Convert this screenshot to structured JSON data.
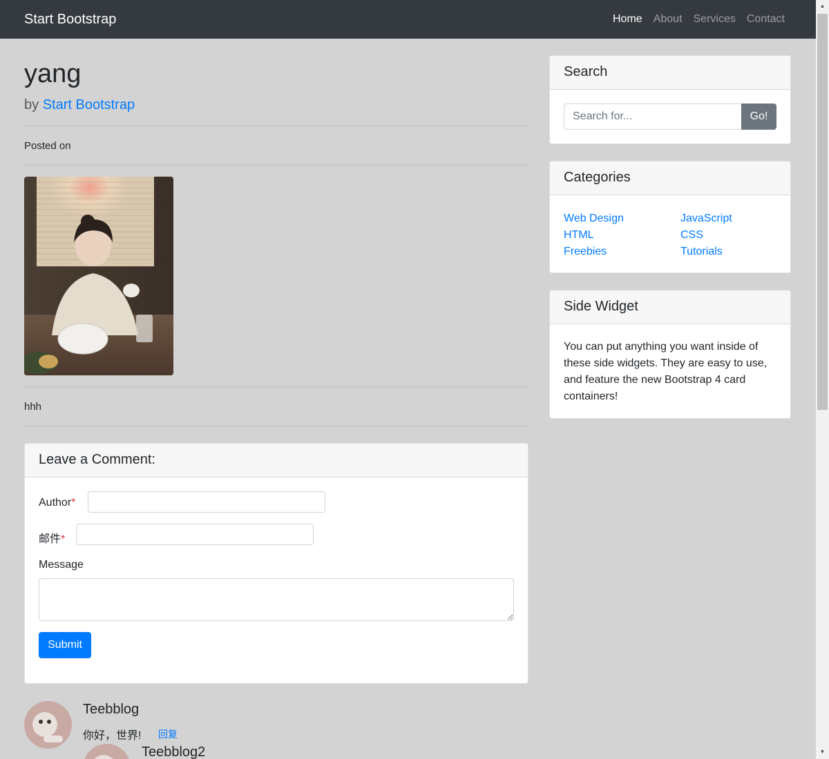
{
  "navbar": {
    "brand": "Start Bootstrap",
    "links": [
      "Home",
      "About",
      "Services",
      "Contact"
    ],
    "active": "Home"
  },
  "post": {
    "title": "yang",
    "by_prefix": "by",
    "author": "Start Bootstrap",
    "posted_on": "Posted on",
    "body": "hhh"
  },
  "search": {
    "title": "Search",
    "placeholder": "Search for...",
    "button": "Go!"
  },
  "categories": {
    "title": "Categories",
    "left": [
      "Web Design",
      "HTML",
      "Freebies"
    ],
    "right": [
      "JavaScript",
      "CSS",
      "Tutorials"
    ]
  },
  "side_widget": {
    "title": "Side Widget",
    "text": "You can put anything you want inside of these side widgets. They are easy to use, and feature the new Bootstrap 4 card containers!"
  },
  "comment_form": {
    "title": "Leave a Comment:",
    "author_label": "Author",
    "email_label": "邮件",
    "required_mark": "*",
    "message_label": "Message",
    "submit": "Submit"
  },
  "comments": [
    {
      "name": "Teebblog",
      "text": "你好，世界!",
      "reply": "回复"
    },
    {
      "name": "Teebblog2"
    }
  ],
  "colors": {
    "navbar": "#343a40",
    "page_bg": "#d3d3d3",
    "link": "#007bff",
    "primary_button": "#007bff",
    "secondary_button": "#6c757d",
    "required": "#dc3545"
  },
  "icons": {
    "scroll_up": "triangle-up",
    "scroll_down": "triangle-down"
  }
}
